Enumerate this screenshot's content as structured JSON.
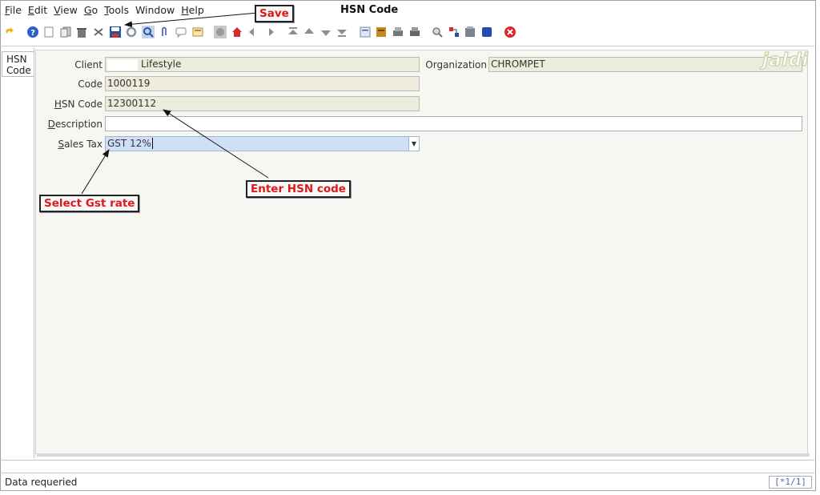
{
  "window": {
    "title": "HSN Code"
  },
  "menu": [
    {
      "pre": "",
      "u": "F",
      "post": "ile"
    },
    {
      "pre": "",
      "u": "E",
      "post": "dit"
    },
    {
      "pre": "",
      "u": "V",
      "post": "iew"
    },
    {
      "pre": "",
      "u": "G",
      "post": "o"
    },
    {
      "pre": "",
      "u": "T",
      "post": "ools"
    },
    {
      "pre": "Window",
      "u": "",
      "post": ""
    },
    {
      "pre": "",
      "u": "H",
      "post": "elp"
    }
  ],
  "toolbar": {
    "icons": [
      "undo-icon",
      "help-icon",
      "new-icon",
      "copy-icon",
      "delete-icon",
      "delete-selection-icon",
      "save-icon",
      "refresh-icon",
      "find-icon",
      "attachment-icon",
      "chat-icon",
      "history-icon",
      "home-icon",
      "parent-icon",
      "previous-icon",
      "next-icon",
      "first-record-icon",
      "previous-record-icon",
      "next-record-icon",
      "last-record-icon",
      "report-icon",
      "archive-icon",
      "print-preview-icon",
      "print-icon",
      "zoom-across-icon",
      "workflow-icon",
      "product-info-icon",
      "end-icon",
      "exit-icon"
    ]
  },
  "tab": {
    "label": "HSN\nCode"
  },
  "form": {
    "client_label": "Client",
    "client_value": "Lifestyle",
    "organization_label": "Organization",
    "organization_value": "CHROMPET",
    "code_label": "Code",
    "code_value": "1000119",
    "hsn_label_underlined": "H",
    "hsn_label_rest": "SN Code",
    "hsn_value": "12300112",
    "description_label_underlined": "D",
    "description_label_rest": "escription",
    "description_value": "",
    "salestax_label_underlined": "S",
    "salestax_label_rest": "ales Tax",
    "salestax_value": "GST 12%"
  },
  "watermark": "jaldi",
  "annotations": {
    "save": "Save",
    "enter_hsn": "Enter HSN code",
    "select_gst": "Select Gst rate"
  },
  "status": {
    "message": "Data requeried",
    "record": "[*1/1]"
  },
  "colors": {
    "callout_text": "#e01818",
    "readonly_field": "#ecebdc",
    "selected_field": "#cfe0f6"
  }
}
